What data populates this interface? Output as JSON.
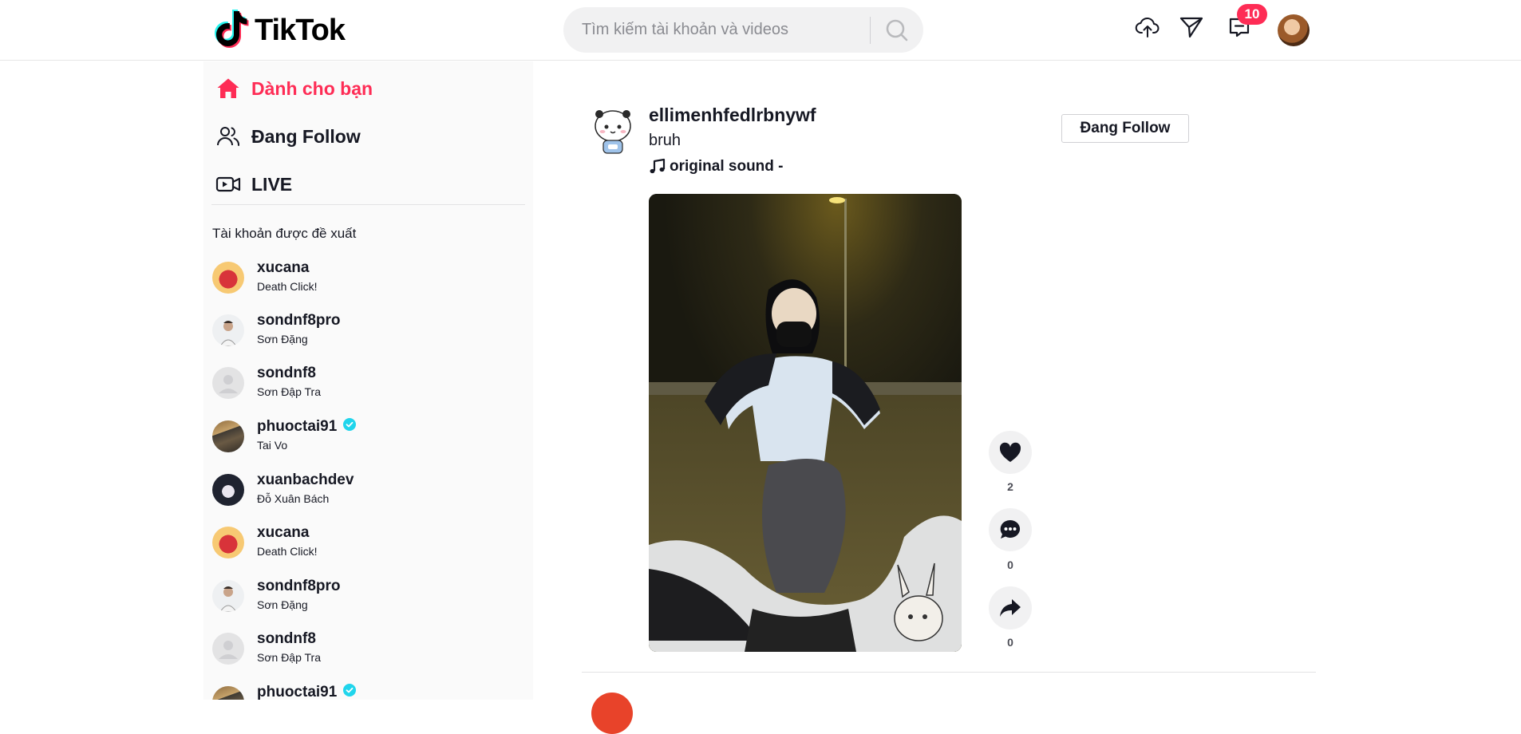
{
  "header": {
    "logo_text": "TikTok",
    "search_placeholder": "Tìm kiếm tài khoản và videos",
    "icons": [
      "upload-icon",
      "send-icon",
      "inbox-icon"
    ],
    "inbox_badge": "10"
  },
  "sidebar": {
    "nav": [
      {
        "label": "Dành cho bạn",
        "icon": "home-icon",
        "active": true
      },
      {
        "label": "Đang Follow",
        "icon": "following-icon",
        "active": false
      },
      {
        "label": "LIVE",
        "icon": "live-icon",
        "active": false
      }
    ],
    "suggested_title": "Tài khoản được đề xuất",
    "accounts": [
      {
        "username": "xucana",
        "nickname": "Death Click!",
        "verified": false
      },
      {
        "username": "sondnf8pro",
        "nickname": "Sơn Đặng",
        "verified": false
      },
      {
        "username": "sondnf8",
        "nickname": "Sơn Đập Tra",
        "verified": false
      },
      {
        "username": "phuoctai91",
        "nickname": "Tai Vo",
        "verified": true
      },
      {
        "username": "xuanbachdev",
        "nickname": "Đỗ Xuân Bách",
        "verified": false
      },
      {
        "username": "xucana",
        "nickname": "Death Click!",
        "verified": false
      },
      {
        "username": "sondnf8pro",
        "nickname": "Sơn Đặng",
        "verified": false
      },
      {
        "username": "sondnf8",
        "nickname": "Sơn Đập Tra",
        "verified": false
      },
      {
        "username": "phuoctai91",
        "nickname": "",
        "verified": true
      }
    ]
  },
  "post": {
    "username": "ellimenhfedlrbnywf",
    "description": "bruh",
    "sound": "original sound -",
    "follow_label": "Đang Follow",
    "likes": "2",
    "comments": "0",
    "shares": "0"
  },
  "colors": {
    "accent": "#fe2c55",
    "verified": "#20d5ec",
    "text": "#161823"
  }
}
